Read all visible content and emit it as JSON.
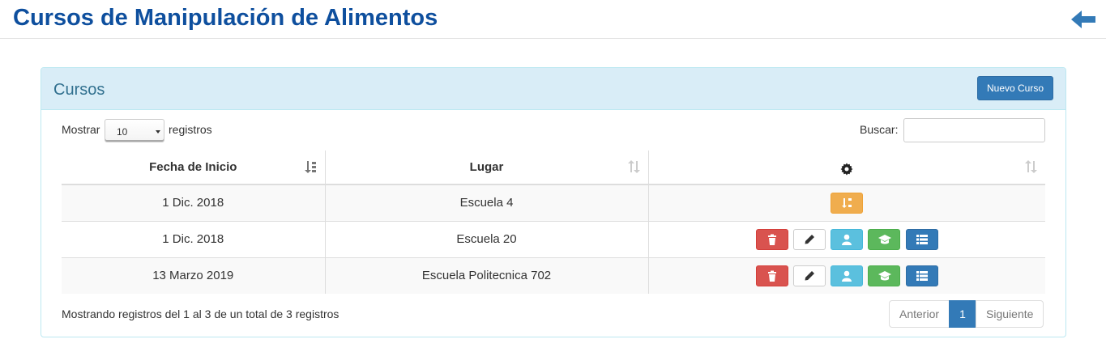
{
  "header": {
    "title": "Cursos de Manipulación de Alimentos",
    "back_icon": "arrow-left-icon"
  },
  "panel": {
    "title": "Cursos",
    "new_button": "Nuevo Curso"
  },
  "controls": {
    "show_label": "Mostrar",
    "page_size": "10",
    "records_label": "registros",
    "search_label": "Buscar:",
    "search_value": ""
  },
  "table": {
    "columns": [
      "Fecha de Inicio",
      "Lugar",
      ""
    ],
    "settings_icon": "gear-icon",
    "rows": [
      {
        "fecha": "1 Dic. 2018",
        "lugar": "Escuela 4",
        "actions": [
          "sort-icon"
        ]
      },
      {
        "fecha": "1 Dic. 2018",
        "lugar": "Escuela 20",
        "actions": [
          "trash-icon",
          "pencil-icon",
          "user-icon",
          "graduation-cap-icon",
          "list-icon"
        ]
      },
      {
        "fecha": "13 Marzo 2019",
        "lugar": "Escuela Politecnica 702",
        "actions": [
          "trash-icon",
          "pencil-icon",
          "user-icon",
          "graduation-cap-icon",
          "list-icon"
        ]
      }
    ]
  },
  "footer": {
    "info": "Mostrando registros del 1 al 3 de un total de 3 registros",
    "prev": "Anterior",
    "page": "1",
    "next": "Siguiente"
  },
  "colors": {
    "title": "#0e4f9e",
    "primary": "#337ab7",
    "danger": "#d9534f",
    "info": "#5bc0de",
    "success": "#5cb85c",
    "warning": "#f0ad4e"
  }
}
